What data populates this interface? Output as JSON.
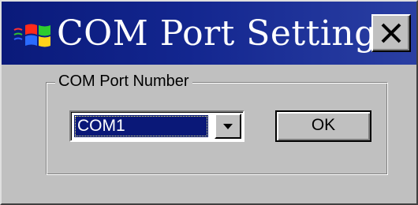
{
  "window": {
    "title": "COM Port Setting",
    "title_bar_color": "#13268f"
  },
  "icons": {
    "app": "windows-flag-icon",
    "close": "close-icon",
    "dropdown": "chevron-down-icon"
  },
  "group": {
    "label": "COM Port  Number"
  },
  "com_select": {
    "value": "COM1",
    "selected_color": "#0a1878"
  },
  "buttons": {
    "ok_label": "OK"
  }
}
